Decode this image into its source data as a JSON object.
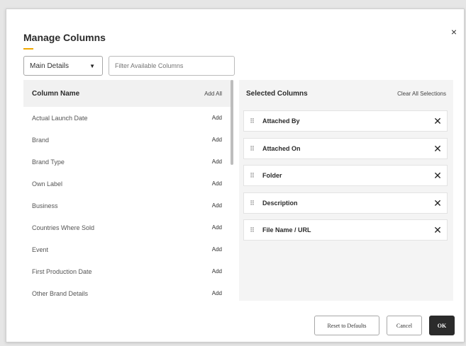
{
  "dialog": {
    "title": "Manage Columns",
    "close_icon": "×"
  },
  "toolbar": {
    "dropdown_value": "Main Details",
    "filter_placeholder": "Filter Available Columns"
  },
  "available": {
    "header": "Column Name",
    "add_all": "Add All",
    "items": [
      {
        "label": "Actual Launch Date",
        "action": "Add"
      },
      {
        "label": "Brand",
        "action": "Add"
      },
      {
        "label": "Brand Type",
        "action": "Add"
      },
      {
        "label": "Own Label",
        "action": "Add"
      },
      {
        "label": "Business",
        "action": "Add"
      },
      {
        "label": "Countries Where Sold",
        "action": "Add"
      },
      {
        "label": "Event",
        "action": "Add"
      },
      {
        "label": "First Production Date",
        "action": "Add"
      },
      {
        "label": "Other Brand Details",
        "action": "Add"
      }
    ]
  },
  "selected": {
    "header": "Selected Columns",
    "clear_all": "Clear All Selections",
    "items": [
      {
        "label": "Attached By"
      },
      {
        "label": "Attached On"
      },
      {
        "label": "Folder"
      },
      {
        "label": "Description"
      },
      {
        "label": "File Name / URL"
      }
    ],
    "remove_icon": "✕",
    "grip_icon": "⠿"
  },
  "footer": {
    "reset_label": "Reset to Defaults",
    "cancel_label": "Cancel",
    "ok_label": "OK"
  },
  "colors": {
    "accent_underline": "#f0a800",
    "ok_button": "#2b2b2b"
  }
}
